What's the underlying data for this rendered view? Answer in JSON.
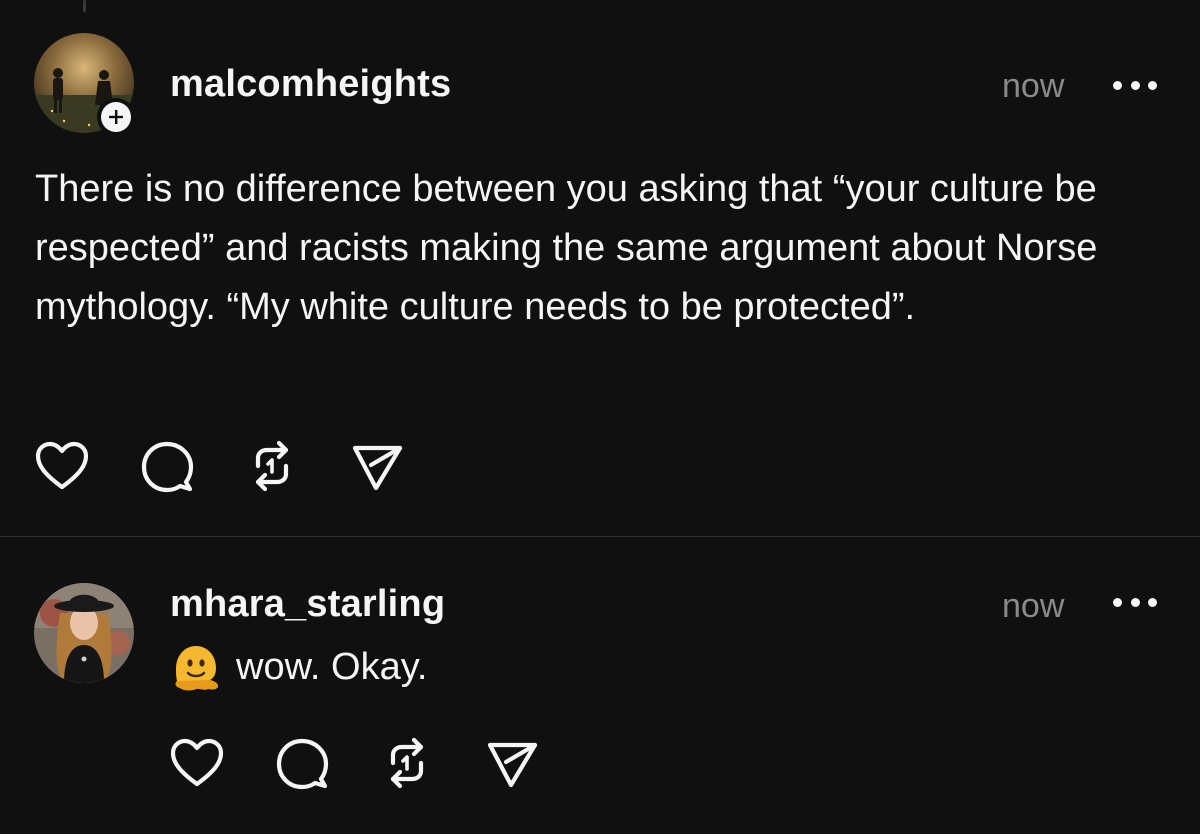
{
  "posts": [
    {
      "username": "malcomheights",
      "timestamp": "now",
      "text": "There is no difference between you asking that “your culture be respected” and racists making the same argument about Norse mythology. “My white culture needs to be protected”.",
      "avatar_icon": "avatar-two-figures-field",
      "has_follow_badge": true,
      "actions": [
        "heart-icon",
        "comment-icon",
        "repost-icon",
        "share-icon"
      ]
    },
    {
      "username": "mhara_starling",
      "timestamp": "now",
      "emoji": "melting-face",
      "text": "wow. Okay.",
      "avatar_icon": "avatar-woman-hat",
      "actions": [
        "heart-icon",
        "comment-icon",
        "repost-icon",
        "share-icon"
      ]
    }
  ],
  "colors": {
    "background": "#101010",
    "text": "#f3f5f7",
    "muted": "#8a8a8a",
    "divider": "#2e2e2e"
  }
}
